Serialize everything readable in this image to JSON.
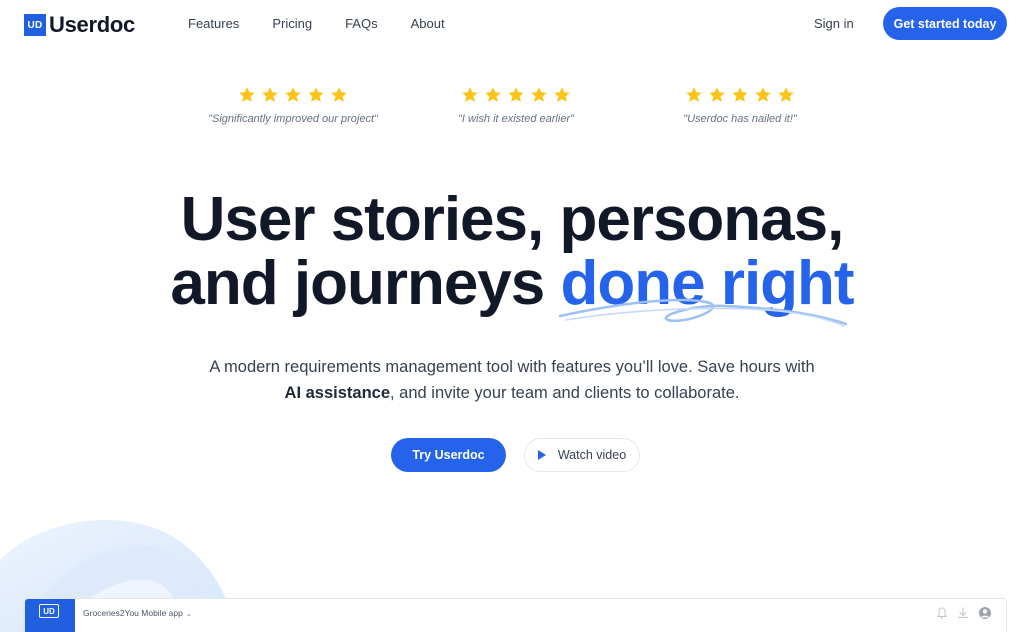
{
  "brand": {
    "badge": "UD",
    "name": "Userdoc",
    "accent_color": "#2563eb"
  },
  "nav": {
    "links": [
      "Features",
      "Pricing",
      "FAQs",
      "About"
    ],
    "sign_in": "Sign in",
    "cta": "Get started today"
  },
  "testimonials": [
    {
      "rating": 5,
      "quote": "\"Significantly improved our project\""
    },
    {
      "rating": 5,
      "quote": "\"I wish it existed earlier\""
    },
    {
      "rating": 5,
      "quote": "\"Userdoc has nailed it!\""
    }
  ],
  "hero": {
    "line1": "User stories, personas,",
    "line2_plain": "and journeys ",
    "line2_accent": "done right",
    "sub_line1": "A modern requirements management tool with features you’ll love. Save hours with",
    "sub_bold": "AI assistance",
    "sub_line2_rest": ", and invite your team and clients to collaborate.",
    "primary_button": "Try Userdoc",
    "secondary_button": "Watch video"
  },
  "preview": {
    "badge": "UD",
    "project_name": "Groceries2You Mobile app",
    "icons": [
      "bell-icon",
      "download-icon",
      "user-icon"
    ]
  }
}
